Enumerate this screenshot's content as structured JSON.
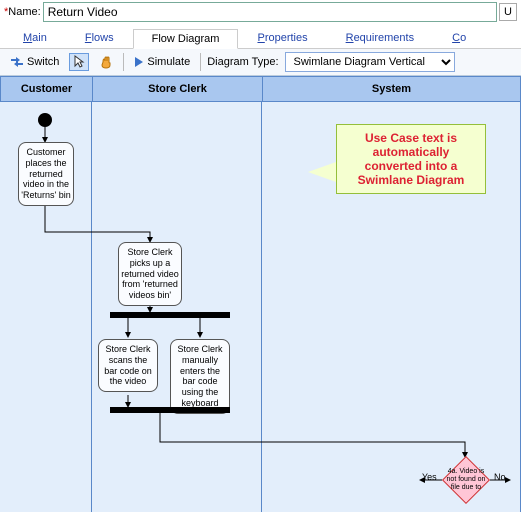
{
  "name_field": {
    "label": "Name:",
    "value": "Return Video"
  },
  "right_btn": "U",
  "tabs": [
    {
      "label": "Main",
      "ul": "M",
      "rest": "ain"
    },
    {
      "label": "Flows",
      "ul": "F",
      "rest": "lows"
    },
    {
      "label": "Flow Diagram",
      "active": true
    },
    {
      "label": "Properties",
      "ul": "P",
      "rest": "roperties"
    },
    {
      "label": "Requirements",
      "ul": "R",
      "rest": "equirements"
    },
    {
      "label": "Co",
      "ul": "C",
      "rest": "o"
    }
  ],
  "toolbar": {
    "switch": "Switch",
    "simulate": "Simulate",
    "dtype_label": "Diagram Type:",
    "dtype_value": "Swimlane Diagram Vertical"
  },
  "lanes": {
    "customer": "Customer",
    "clerk": "Store Clerk",
    "system": "System"
  },
  "callout": "Use Case text is automatically converted into a Swimlane Diagram",
  "nodes": {
    "cust1": "Customer places the returned video in the 'Returns' bin",
    "clerk1": "Store Clerk picks up a returned video from 'returned videos bin'",
    "clerk2": "Store Clerk scans the bar code on the video",
    "clerk3": "Store Clerk manually enters the bar code using the keyboard",
    "diamond": "4a. Video is not found on file due to"
  },
  "yn": {
    "yes": "Yes",
    "no": "No"
  }
}
